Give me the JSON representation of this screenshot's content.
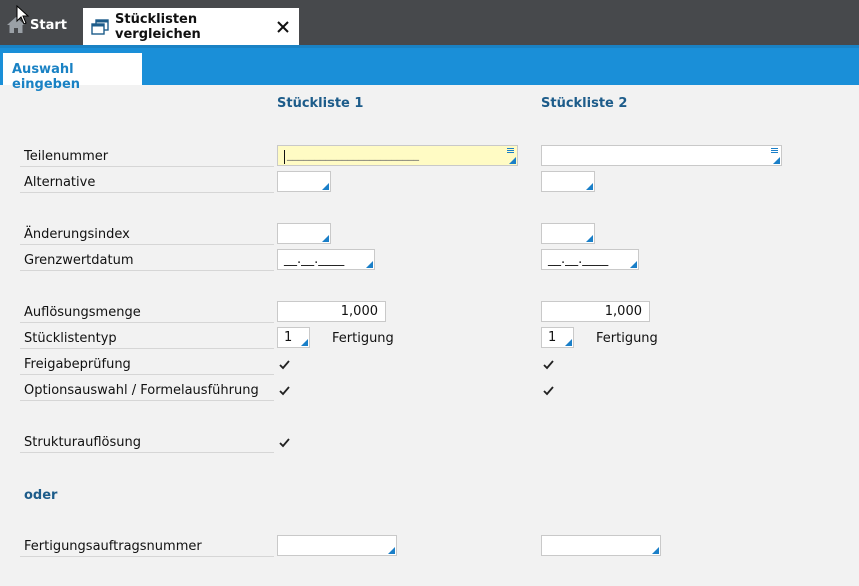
{
  "tabs": {
    "start_label": "Start",
    "active_label": "Stücklisten vergleichen"
  },
  "subtab": {
    "label": "Auswahl eingeben"
  },
  "columns": {
    "col1": "Stückliste 1",
    "col2": "Stückliste 2"
  },
  "fields": {
    "teilenummer": "Teilenummer",
    "alternative": "Alternative",
    "aenderungsindex": "Änderungsindex",
    "grenzwertdatum": "Grenzwertdatum",
    "aufloesungsmenge": "Auflösungsmenge",
    "stuecklistentyp": "Stücklistentyp",
    "freigabepruefung": "Freigabeprüfung",
    "optionsauswahl": "Optionsauswahl / Formelausführung",
    "strukturaufloesung": "Strukturauflösung",
    "oder": "oder",
    "fertigungsauftragsnummer": "Fertigungsauftragsnummer"
  },
  "values": {
    "date_placeholder": "__.__.____",
    "teilenummer_mask": "________________________",
    "menge1": "1,000",
    "menge2": "1,000",
    "typ1": "1",
    "typ2": "1",
    "typ_label1": "Fertigung",
    "typ_label2": "Fertigung"
  },
  "colors": {
    "accent": "#1a8fd8",
    "header": "#47494c",
    "label_blue": "#1d5c8a",
    "highlight": "#fffbc4"
  }
}
